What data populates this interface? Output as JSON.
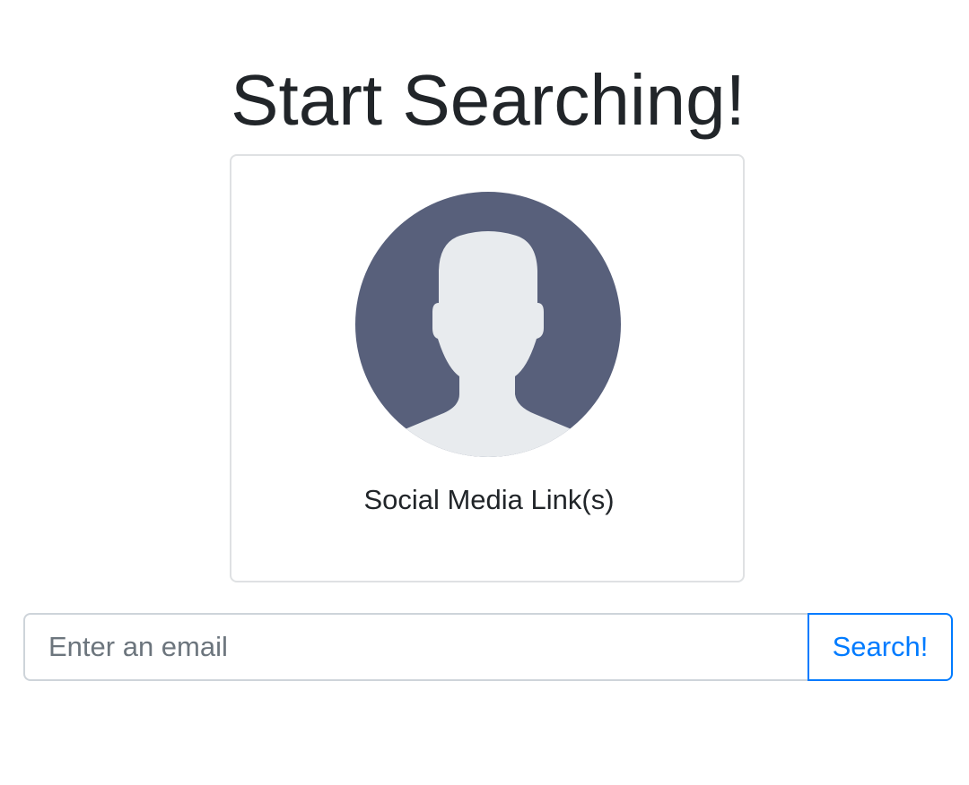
{
  "page": {
    "title": "Start Searching!"
  },
  "card": {
    "avatar_icon": "default-user-avatar-icon",
    "avatar_background_color": "#58607b",
    "avatar_silhouette_color": "#e8ebee",
    "caption": "Social Media Link(s)"
  },
  "search": {
    "placeholder": "Enter an email",
    "value": "",
    "button_label": "Search!",
    "accent_color": "#007bff"
  }
}
